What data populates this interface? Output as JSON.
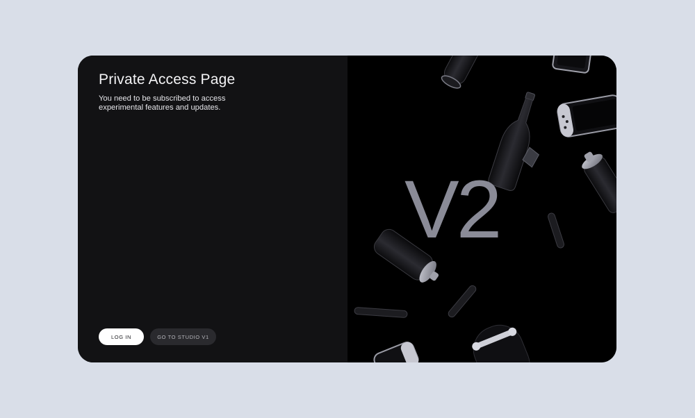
{
  "page": {
    "title": "Private Access Page",
    "description": "You need to be subscribed to access experimental features and updates."
  },
  "buttons": {
    "login_label": "LOG IN",
    "studio_label": "GO TO STUDIO V1"
  },
  "hero": {
    "logo_text": "V2",
    "objects": [
      "can-icon",
      "phone-icon",
      "bottle-icon",
      "game-console-icon",
      "spray-can-icon",
      "spray-can-icon",
      "stick-icon",
      "stick-icon",
      "stick-icon",
      "stick-icon",
      "skateboard-icon",
      "game-console-icon"
    ]
  },
  "colors": {
    "page_bg": "#d9dee8",
    "panel_bg": "#121214",
    "hero_bg": "#000000",
    "logo": "#8a8b97",
    "login_bg": "#ffffff",
    "studio_bg": "#2a2a2e"
  }
}
